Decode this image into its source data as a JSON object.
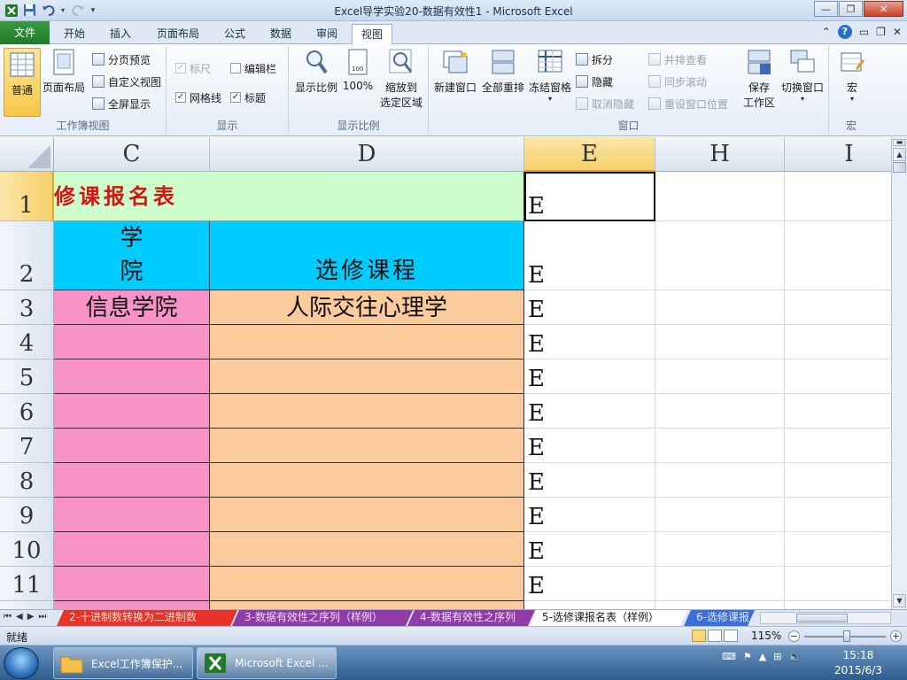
{
  "window": {
    "title": "Excel导学实验20-数据有效性1 - Microsoft Excel"
  },
  "tabs": [
    {
      "label": "文件"
    },
    {
      "label": "开始"
    },
    {
      "label": "插入"
    },
    {
      "label": "页面布局"
    },
    {
      "label": "公式"
    },
    {
      "label": "数据"
    },
    {
      "label": "审阅"
    },
    {
      "label": "视图",
      "active": true
    }
  ],
  "ribbon": {
    "workbook_views": {
      "label": "工作簿视图",
      "normal": "普通",
      "page_layout": "页面布局",
      "page_break": "分页预览",
      "custom_views": "自定义视图",
      "full_screen": "全屏显示"
    },
    "show": {
      "label": "显示",
      "ruler": "标尺",
      "formula_bar": "编辑栏",
      "gridlines": "网格线",
      "headings": "标题"
    },
    "zoom": {
      "label": "显示比例",
      "zoom": "显示比例",
      "zoom100": "100%",
      "zoom_selection_1": "缩放到",
      "zoom_selection_2": "选定区域"
    },
    "window": {
      "label": "窗口",
      "new_window": "新建窗口",
      "arrange_all": "全部重排",
      "freeze_panes": "冻结窗格",
      "split": "拆分",
      "hide": "隐藏",
      "unhide": "取消隐藏",
      "side_by_side": "并排查看",
      "sync_scroll": "同步滚动",
      "reset_position": "重设窗口位置",
      "save_workspace_1": "保存",
      "save_workspace_2": "工作区",
      "switch_windows": "切换窗口"
    },
    "macros": {
      "label": "宏",
      "macros": "宏"
    }
  },
  "sheet": {
    "columns": [
      "C",
      "D",
      "E",
      "H",
      "I"
    ],
    "rows": [
      "1",
      "2",
      "3",
      "4",
      "5",
      "6",
      "7",
      "8",
      "9",
      "10",
      "11"
    ],
    "title_cell": "修课报名表",
    "header_college": "学\n院",
    "header_college_top": "学",
    "header_college_bottom": "院",
    "header_course": "选修课程",
    "row3_college": "信息学院",
    "row3_course": "人际交往心理学",
    "e_values": [
      "E",
      "E",
      "E",
      "E",
      "E",
      "E",
      "E",
      "E",
      "E",
      "E",
      "E"
    ]
  },
  "sheet_tabs": [
    {
      "label": "2-十进制数转换为二进制数",
      "color": "red"
    },
    {
      "label": "3-数据有效性之序列（样例）",
      "color": "purple"
    },
    {
      "label": "4-数据有效性之序列",
      "color": "purple"
    },
    {
      "label": "5-选修课报名表（样例）",
      "color": "white",
      "active": true
    },
    {
      "label": "6-选修课报",
      "color": "blue"
    }
  ],
  "status": {
    "ready": "就绪",
    "zoom": "115%"
  },
  "taskbar": {
    "items": [
      {
        "label": "Excel工作簿保护..."
      },
      {
        "label": "Microsoft Excel ..."
      }
    ],
    "time": "15:18",
    "date": "2015/6/3"
  },
  "colors": {
    "pink": "#f893c8",
    "orange": "#fccb9c",
    "cyan": "#00ccff",
    "green": "#ccffcc",
    "title_red": "#d51414"
  }
}
